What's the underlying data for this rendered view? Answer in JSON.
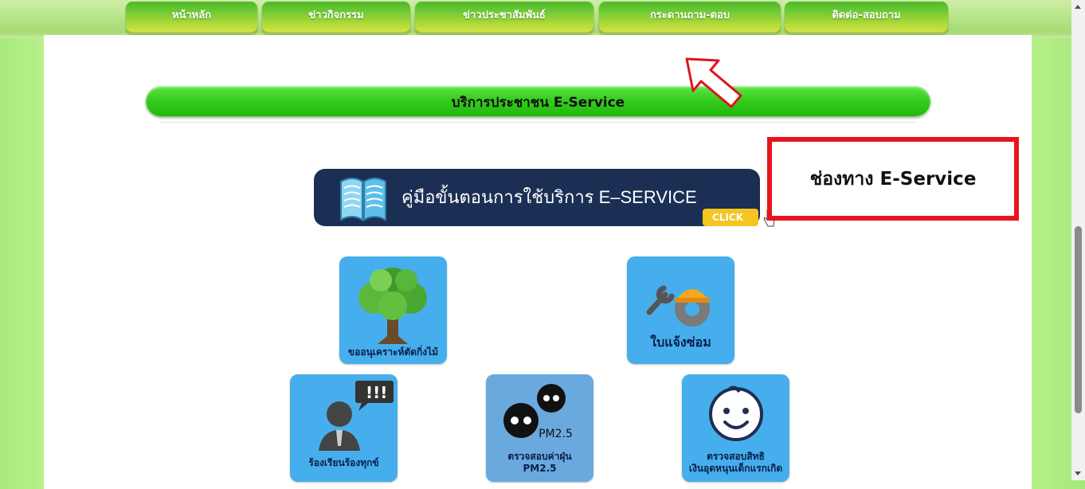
{
  "nav": {
    "items": [
      {
        "label": "หน้าหลัก"
      },
      {
        "label": "ข่าวกิจกรรม"
      },
      {
        "label": "ข่าวประชาสัมพันธ์"
      },
      {
        "label": "กระดานถาม-ตอบ"
      },
      {
        "label": "ติดต่อ-สอบถาม"
      }
    ]
  },
  "service": {
    "title": "บริการประชาชน E-Service"
  },
  "guide_banner": {
    "text": "คู่มือขั้นตอนการใช้บริการ E–SERVICE",
    "click_label": "CLICK",
    "icon": "open-book-icon"
  },
  "callout": {
    "text": "ช่องทาง E-Service",
    "border_color": "#e8151c"
  },
  "tiles": [
    {
      "label": "ขออนุเคราะห์ตัดกิ่งไม้",
      "icon": "tree-icon"
    },
    {
      "label": "ใบแจ้งซ่อม",
      "icon": "repair-tools-icon"
    },
    {
      "label": "ร้องเรียนร้องทุกข์",
      "icon": "complaint-person-icon"
    },
    {
      "label": "PM2.5",
      "label2": "ตรวจสอบค่าฝุ่น",
      "label3": "PM2.5",
      "icon": "dust-monsters-icon"
    },
    {
      "label": "ตรวจสอบสิทธิ",
      "label2": "เงินอุดหนุนเด็กแรกเกิด",
      "icon": "baby-face-icon"
    }
  ],
  "colors": {
    "accent_green": "#37cc1f",
    "tile_blue": "#46aeec",
    "banner_navy": "#1b2f55",
    "click_yellow": "#f5c520"
  }
}
